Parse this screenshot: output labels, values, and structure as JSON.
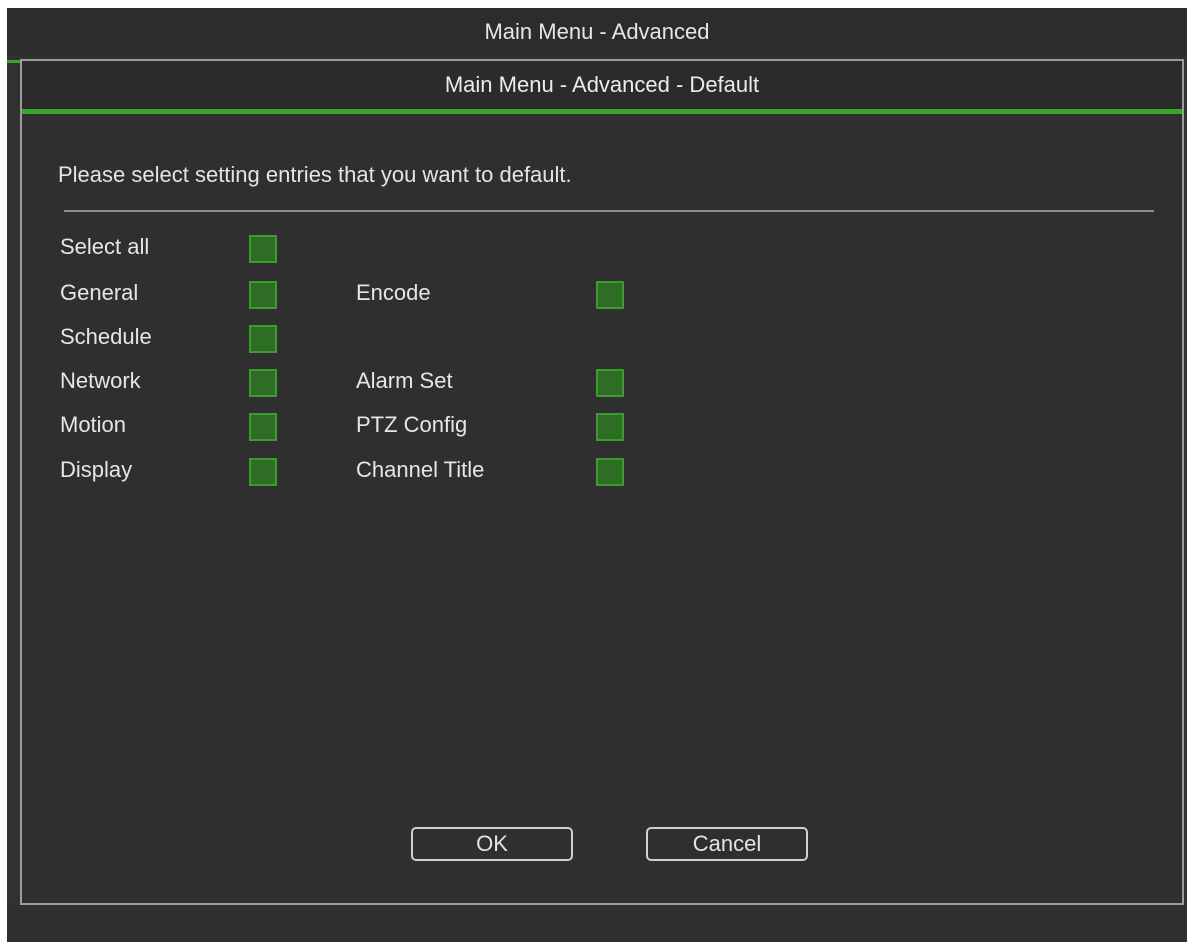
{
  "window": {
    "title": "Main Menu - Advanced"
  },
  "dialog": {
    "title": "Main Menu - Advanced - Default",
    "instruction": "Please select setting entries that you want to default.",
    "options": {
      "select_all": {
        "label": "Select all",
        "checked": false
      },
      "general": {
        "label": "General",
        "checked": false
      },
      "encode": {
        "label": "Encode",
        "checked": false
      },
      "schedule": {
        "label": "Schedule",
        "checked": false
      },
      "network": {
        "label": "Network",
        "checked": false
      },
      "alarm_set": {
        "label": "Alarm Set",
        "checked": false
      },
      "motion": {
        "label": "Motion",
        "checked": false
      },
      "ptz_config": {
        "label": "PTZ Config",
        "checked": false
      },
      "display": {
        "label": "Display",
        "checked": false
      },
      "channel_title": {
        "label": "Channel Title",
        "checked": false
      }
    },
    "buttons": {
      "ok": "OK",
      "cancel": "Cancel"
    }
  },
  "colors": {
    "accent_green": "#37a829",
    "checkbox_fill": "#2e6e24",
    "background": "#2f2f2f"
  }
}
